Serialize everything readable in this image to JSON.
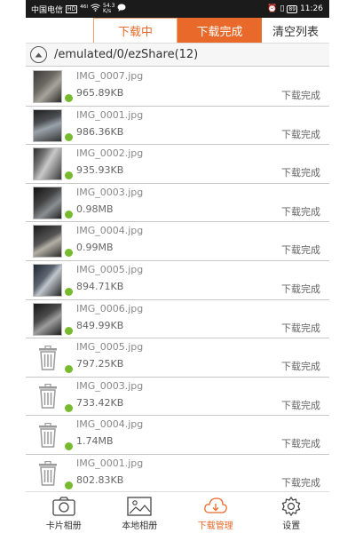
{
  "status_bar": {
    "carrier": "中国电信",
    "carrier_badge": "HD",
    "signal_text": "⁴⁶ᴵ",
    "speed_value": "54.3",
    "speed_unit": "K/s",
    "right_icons": "⏰ ▯",
    "battery": "89",
    "time": "11:26"
  },
  "tabs": {
    "downloading": "下载中",
    "done": "下载完成",
    "clear": "清空列表"
  },
  "path": "/emulated/0/ezShare(12)",
  "files": [
    {
      "name": "IMG_0007.jpg",
      "size": "965.89KB",
      "status": "下载完成",
      "thumb": "photo"
    },
    {
      "name": "IMG_0001.jpg",
      "size": "986.36KB",
      "status": "下载完成",
      "thumb": "photo"
    },
    {
      "name": "IMG_0002.jpg",
      "size": "935.93KB",
      "status": "下载完成",
      "thumb": "photo"
    },
    {
      "name": "IMG_0003.jpg",
      "size": "0.98MB",
      "status": "下载完成",
      "thumb": "photo"
    },
    {
      "name": "IMG_0004.jpg",
      "size": "0.99MB",
      "status": "下载完成",
      "thumb": "photo"
    },
    {
      "name": "IMG_0005.jpg",
      "size": "894.71KB",
      "status": "下载完成",
      "thumb": "photo"
    },
    {
      "name": "IMG_0006.jpg",
      "size": "849.99KB",
      "status": "下载完成",
      "thumb": "photo"
    },
    {
      "name": "IMG_0005.jpg",
      "size": "797.25KB",
      "status": "下载完成",
      "thumb": "trash"
    },
    {
      "name": "IMG_0003.jpg",
      "size": "733.42KB",
      "status": "下载完成",
      "thumb": "trash"
    },
    {
      "name": "IMG_0004.jpg",
      "size": "1.74MB",
      "status": "下载完成",
      "thumb": "trash"
    },
    {
      "name": "IMG_0001.jpg",
      "size": "802.83KB",
      "status": "下载完成",
      "thumb": "trash"
    }
  ],
  "nav": {
    "card_album": "卡片相册",
    "local_album": "本地相册",
    "download_manager": "下载管理",
    "settings": "设置"
  },
  "colors": {
    "accent": "#e8692a",
    "check": "#76bb2e"
  }
}
